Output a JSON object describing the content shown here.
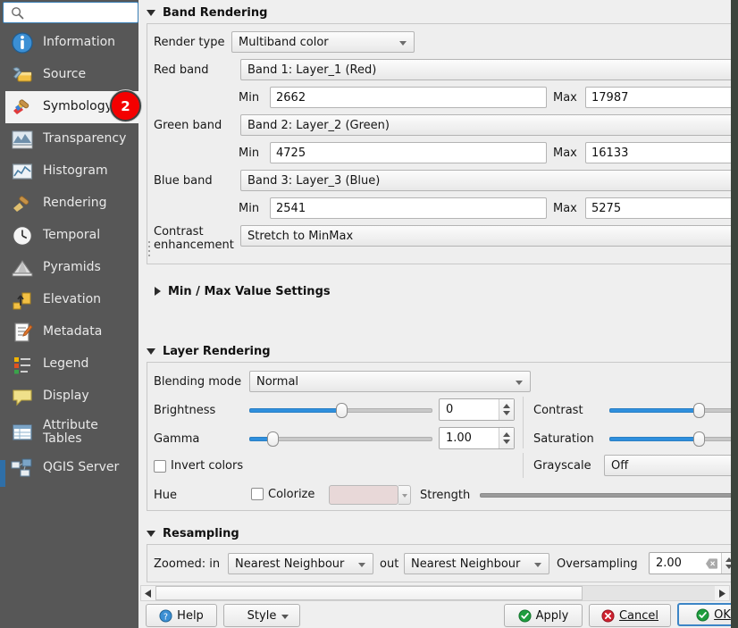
{
  "sidebar": {
    "search": {
      "value": "",
      "placeholder": "",
      "icon": "search-icon"
    },
    "badge": {
      "value": "2",
      "color": "#f40000"
    },
    "items": [
      {
        "label": "Information",
        "icon": "info-icon"
      },
      {
        "label": "Source",
        "icon": "source-wrench-icon"
      },
      {
        "label": "Symbology",
        "icon": "paintbrush-icon",
        "selected": true
      },
      {
        "label": "Transparency",
        "icon": "transparency-icon"
      },
      {
        "label": "Histogram",
        "icon": "histogram-icon"
      },
      {
        "label": "Rendering",
        "icon": "rendering-brush-icon"
      },
      {
        "label": "Temporal",
        "icon": "clock-icon"
      },
      {
        "label": "Pyramids",
        "icon": "pyramids-icon"
      },
      {
        "label": "Elevation",
        "icon": "elevation-icon"
      },
      {
        "label": "Metadata",
        "icon": "metadata-icon"
      },
      {
        "label": "Legend",
        "icon": "legend-icon"
      },
      {
        "label": "Display",
        "icon": "display-balloon-icon"
      },
      {
        "label": "Attribute Tables",
        "icon": "attribute-tables-icon"
      },
      {
        "label": "QGIS Server",
        "icon": "qgis-server-icon"
      }
    ]
  },
  "band_rendering": {
    "title": "Band Rendering",
    "render_type_label": "Render type",
    "render_type_value": "Multiband color",
    "red_band_label": "Red band",
    "red_band_value": "Band 1: Layer_1 (Red)",
    "green_band_label": "Green band",
    "green_band_value": "Band 2: Layer_2 (Green)",
    "blue_band_label": "Blue band",
    "blue_band_value": "Band 3: Layer_3 (Blue)",
    "min_label": "Min",
    "max_label": "Max",
    "red_min": "2662",
    "red_max": "17987",
    "green_min": "4725",
    "green_max": "16133",
    "blue_min": "2541",
    "blue_max": "5275",
    "contrast_enhancement_label_line1": "Contrast",
    "contrast_enhancement_label_line2": "enhancement",
    "contrast_enhancement_value": "Stretch to MinMax",
    "min_max_settings_title": "Min / Max Value Settings"
  },
  "layer_rendering": {
    "title": "Layer Rendering",
    "blending_mode_label": "Blending mode",
    "blending_mode_value": "Normal",
    "brightness_label": "Brightness",
    "brightness_value": "0",
    "contrast_label": "Contrast",
    "gamma_label": "Gamma",
    "gamma_value": "1.00",
    "saturation_label": "Saturation",
    "invert_colors_label": "Invert colors",
    "grayscale_label": "Grayscale",
    "grayscale_value": "Off",
    "hue_label": "Hue",
    "colorize_label": "Colorize",
    "colorize_color": "#e8d8d8",
    "strength_label": "Strength"
  },
  "resampling": {
    "title": "Resampling",
    "zoomed_in_label": "Zoomed: in",
    "zoomed_in_value": "Nearest Neighbour",
    "zoomed_out_label": "out",
    "zoomed_out_value": "Nearest Neighbour",
    "oversampling_label": "Oversampling",
    "oversampling_value": "2.00"
  },
  "buttons": {
    "help": "Help",
    "style": "Style",
    "apply": "Apply",
    "cancel": "Cancel",
    "ok": "OK"
  }
}
